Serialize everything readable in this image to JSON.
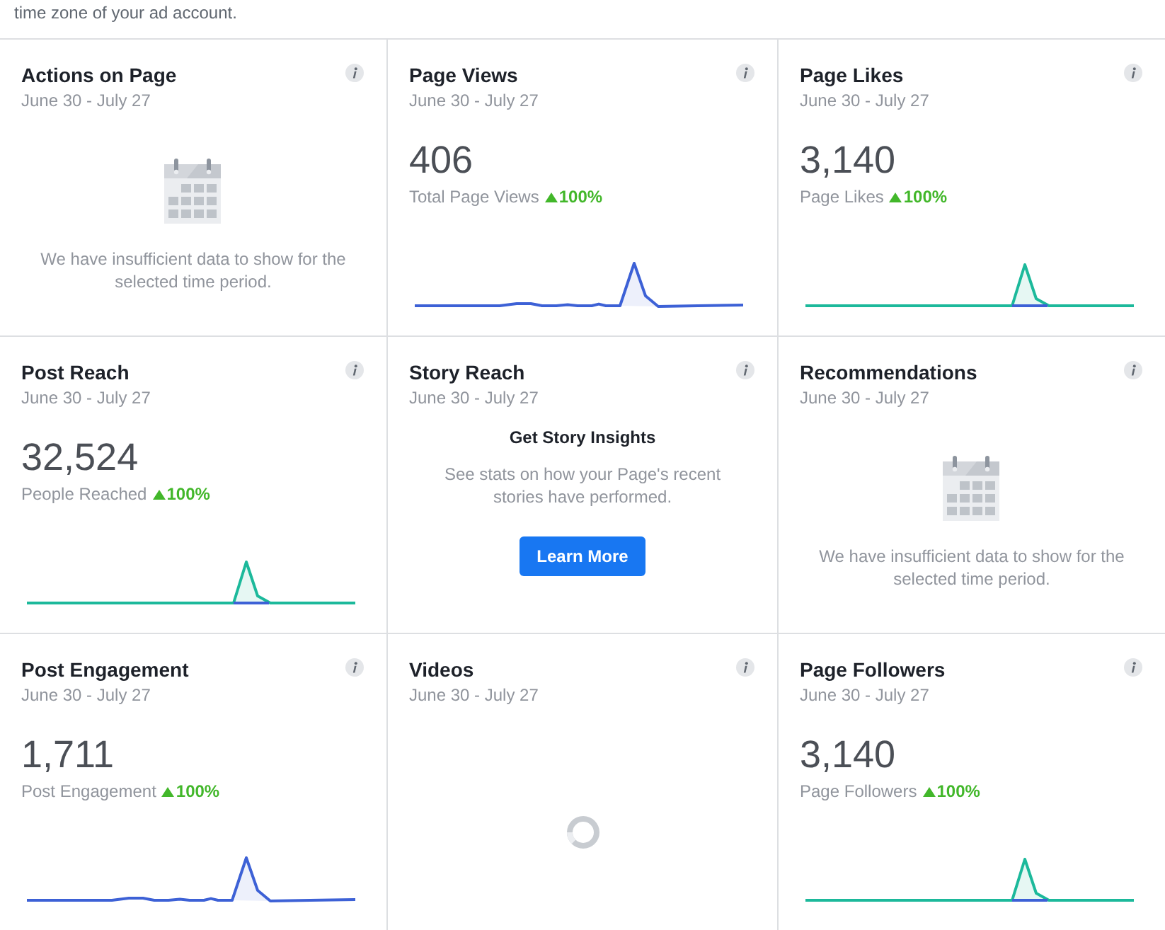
{
  "note": "time zone of your ad account.",
  "cards": [
    {
      "kind": "empty",
      "title": "Actions on Page",
      "date": "June 30 - July 27",
      "message": "We have insufficient data to show for the selected time period."
    },
    {
      "kind": "metric",
      "title": "Page Views",
      "date": "June 30 - July 27",
      "value": "406",
      "caption": "Total Page Views",
      "rising": true,
      "change": "100%",
      "sparkline": {
        "kind": "single"
      }
    },
    {
      "kind": "metric",
      "title": "Page Likes",
      "date": "June 30 - July 27",
      "value": "3,140",
      "caption": "Page Likes",
      "rising": true,
      "change": "100%",
      "sparkline": {
        "kind": "split"
      }
    },
    {
      "kind": "metric",
      "title": "Post Reach",
      "date": "June 30 - July 27",
      "value": "32,524",
      "caption": "People Reached",
      "rising": true,
      "change": "100%",
      "sparkline": {
        "kind": "split"
      }
    },
    {
      "kind": "promo",
      "title": "Story Reach",
      "date": "June 30 - July 27",
      "heading": "Get Story Insights",
      "message": "See stats on how your Page's recent stories have performed.",
      "button": "Learn More"
    },
    {
      "kind": "empty",
      "title": "Recommendations",
      "date": "June 30 - July 27",
      "message": "We have insufficient data to show for the selected time period."
    },
    {
      "kind": "metric",
      "title": "Post Engagement",
      "date": "June 30 - July 27",
      "value": "1,711",
      "caption": "Post Engagement",
      "rising": true,
      "change": "100%",
      "sparkline": {
        "kind": "single"
      }
    },
    {
      "kind": "loading",
      "title": "Videos",
      "date": "June 30 - July 27"
    },
    {
      "kind": "metric",
      "title": "Page Followers",
      "date": "June 30 - July 27",
      "value": "3,140",
      "caption": "Page Followers",
      "rising": true,
      "change": "100%",
      "sparkline": {
        "kind": "split"
      }
    }
  ]
}
